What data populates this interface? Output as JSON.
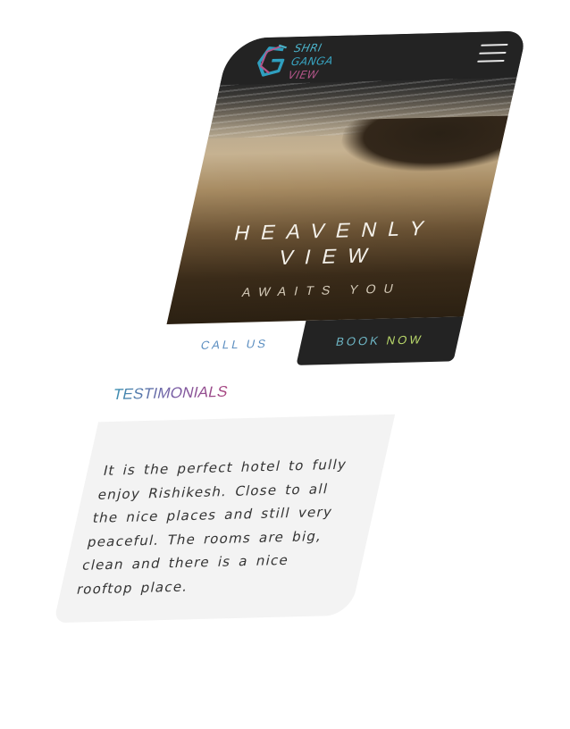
{
  "brand": {
    "line1": "SHRI",
    "line2": "GANGA",
    "line3": "VIEW"
  },
  "hero": {
    "title_line1": "HEAVENLY",
    "title_line2": "VIEW",
    "subtitle": "AWAITS YOU"
  },
  "actions": {
    "call_label": "CALL US",
    "book_label_1": "BOOK",
    "book_label_2": "NOW"
  },
  "testimonials": {
    "heading": "TESTIMONIALS",
    "quote": "It is the perfect hotel to fully enjoy Rishikesh. Close to all the nice places and still very peaceful. The rooms are big, clean and there is a nice rooftop place."
  },
  "icons": {
    "logo": "g-logo-icon",
    "menu": "hamburger-menu-icon"
  },
  "colors": {
    "nav": "#232323",
    "accent_teal": "#38a5c2",
    "accent_pink": "#b5568a",
    "accent_green": "#b9d86a",
    "card": "#f3f3f3"
  }
}
